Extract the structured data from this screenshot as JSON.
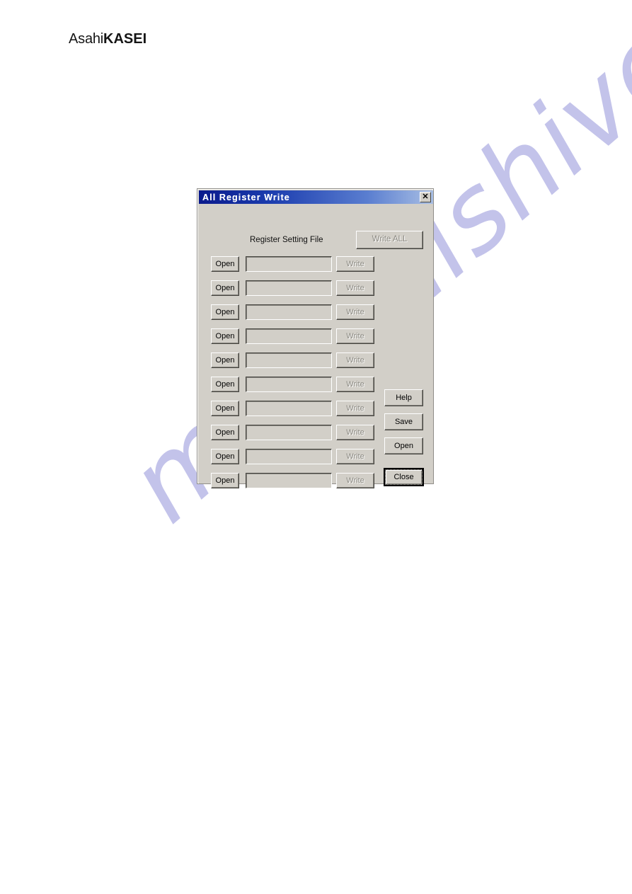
{
  "brand": {
    "part1": "Asahi",
    "part2": "KASEI"
  },
  "watermark": {
    "text": "manualshive.com",
    "color": "#c3c3ea"
  },
  "dialog": {
    "title": "All Register Write",
    "title_bar_color": "#0a1a8c",
    "face_color": "#d2cfc8",
    "close_icon_label": "✕",
    "header_label": "Register Setting File",
    "write_all_button": {
      "label": "Write ALL",
      "enabled": false
    },
    "rows": [
      {
        "open_label": "Open",
        "path_value": "",
        "path_placeholder": "",
        "write_label": "Write",
        "write_enabled": false
      },
      {
        "open_label": "Open",
        "path_value": "",
        "path_placeholder": "",
        "write_label": "Write",
        "write_enabled": false
      },
      {
        "open_label": "Open",
        "path_value": "",
        "path_placeholder": "",
        "write_label": "Write",
        "write_enabled": false
      },
      {
        "open_label": "Open",
        "path_value": "",
        "path_placeholder": "",
        "write_label": "Write",
        "write_enabled": false
      },
      {
        "open_label": "Open",
        "path_value": "",
        "path_placeholder": "",
        "write_label": "Write",
        "write_enabled": false
      },
      {
        "open_label": "Open",
        "path_value": "",
        "path_placeholder": "",
        "write_label": "Write",
        "write_enabled": false
      },
      {
        "open_label": "Open",
        "path_value": "",
        "path_placeholder": "",
        "write_label": "Write",
        "write_enabled": false
      },
      {
        "open_label": "Open",
        "path_value": "",
        "path_placeholder": "",
        "write_label": "Write",
        "write_enabled": false
      },
      {
        "open_label": "Open",
        "path_value": "",
        "path_placeholder": "",
        "write_label": "Write",
        "write_enabled": false
      },
      {
        "open_label": "Open",
        "path_value": "",
        "path_placeholder": "",
        "write_label": "Write",
        "write_enabled": false
      }
    ],
    "side_buttons": {
      "help_label": "Help",
      "save_label": "Save",
      "open_label": "Open",
      "close_label": "Close"
    }
  }
}
